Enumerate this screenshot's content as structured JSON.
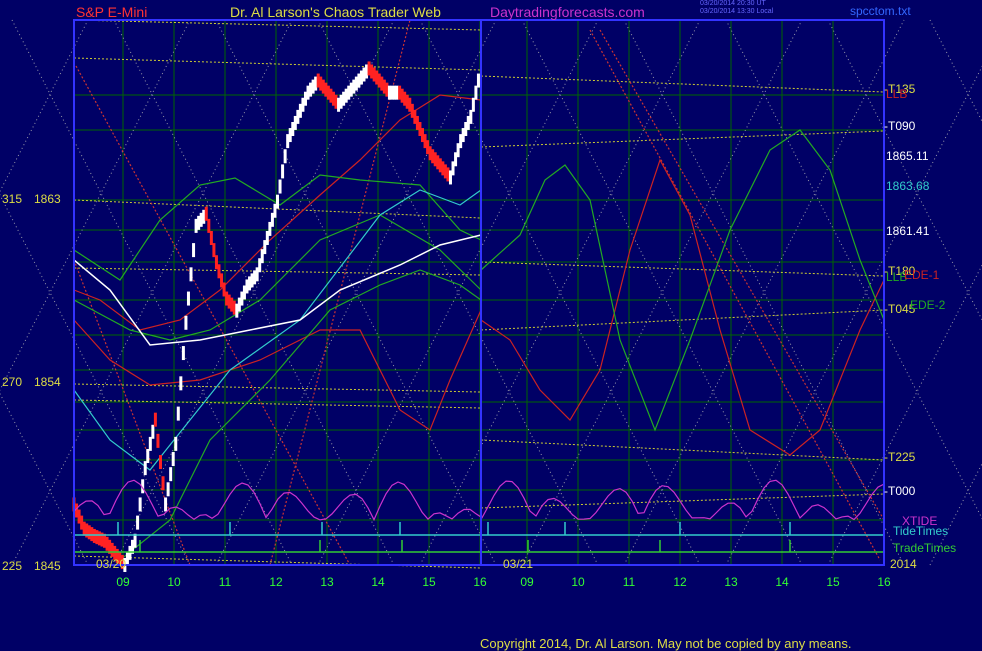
{
  "header": {
    "instrument": "S&P E-Mini",
    "title": "Dr. Al Larson's Chaos Trader Web",
    "site": "Daytradingforecasts.com",
    "ts1": "03/20/2014 20:30 UT",
    "ts2": "03/20/2014 13:30 Local",
    "file": "spcctom.txt"
  },
  "footer": {
    "copyright": "Copyright 2014, Dr. Al Larson. May not be copied by any means."
  },
  "colors": {
    "background": "#000066",
    "frame": "#3333ff",
    "grid": "#006600",
    "yellow_lines": "#cccc33",
    "white_dotted": "#9999aa",
    "red_dotted": "#cc3333",
    "price_up": "#ffffff",
    "price_down": "#ff2222",
    "xtide": "#cc33cc",
    "tide_times": "#33cccc",
    "trade_times": "#33cc33"
  },
  "chart_data": {
    "type": "line",
    "title": "S&P E-Mini",
    "xlabel": "",
    "ylabel": "",
    "x_tick_labels": [
      "09",
      "10",
      "11",
      "12",
      "13",
      "14",
      "15",
      "16",
      "09",
      "10",
      "11",
      "12",
      "13",
      "14",
      "15",
      "16"
    ],
    "date_labels": [
      "03/20",
      "03/21"
    ],
    "year_label": "2014",
    "left_axis_labels": [
      {
        "deg": "315",
        "price": "1863"
      },
      {
        "deg": "270",
        "price": "1854"
      },
      {
        "deg": "225",
        "price": "1845"
      }
    ],
    "right_axis_labels": [
      "T135",
      "T090",
      "1865.11",
      "1863.68",
      "1861.41",
      "T180",
      "T045",
      "T225",
      "T000"
    ],
    "price_range": [
      1845,
      1867.5
    ],
    "legend": [
      "EDE-1",
      "EDE-2",
      "XTIDE",
      "TideTimes",
      "TradeTimes",
      "LLB"
    ],
    "series": [
      {
        "name": "S&P E-Mini",
        "x_hours": [
          8.0,
          8.2,
          8.4,
          8.6,
          8.8,
          9.0,
          9.2,
          9.4,
          9.6,
          9.8,
          10.0,
          10.2,
          10.4,
          10.6,
          10.8,
          11.0,
          11.2,
          11.4,
          11.6,
          11.8,
          12.0,
          12.2,
          12.4,
          12.6,
          12.8,
          13.0,
          13.2,
          13.4,
          13.6,
          13.8,
          14.0,
          14.2,
          14.4,
          14.6,
          14.8,
          15.0,
          15.2,
          15.4,
          15.6,
          15.8,
          16.0
        ],
        "values": [
          1847.5,
          1846.5,
          1846.2,
          1846.0,
          1845.5,
          1845.0,
          1846.0,
          1849.0,
          1851.0,
          1847.5,
          1850.0,
          1855.0,
          1859.0,
          1859.5,
          1857.5,
          1856.0,
          1855.5,
          1856.5,
          1857.0,
          1858.5,
          1860.0,
          1862.5,
          1863.5,
          1864.5,
          1865.0,
          1864.5,
          1864.0,
          1864.5,
          1865.0,
          1865.5,
          1865.0,
          1864.5,
          1864.5,
          1864.0,
          1863.0,
          1862.0,
          1861.5,
          1861.0,
          1862.5,
          1863.5,
          1865.5
        ]
      }
    ]
  }
}
